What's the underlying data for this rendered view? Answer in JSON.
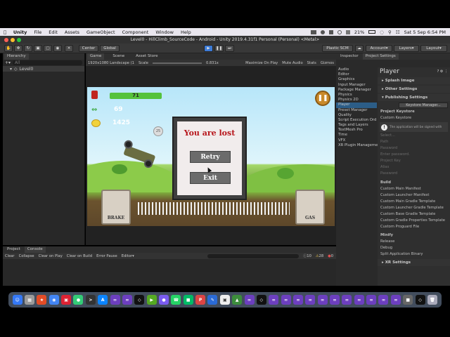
{
  "menubar": {
    "apple": "",
    "app": "Unity",
    "items": [
      "File",
      "Edit",
      "Assets",
      "GameObject",
      "Component",
      "Window",
      "Help"
    ],
    "battery": "21%",
    "clock": "Sat 5 Sep  6:54 PM"
  },
  "window": {
    "title": "Level0 - HillClimb_SourceCode - Android - Unity 2019.4.31f1 Personal (Personal) <Metal>"
  },
  "toolbar": {
    "center": "Center",
    "global": "Global",
    "collab": "Plastic SCM",
    "account": "Account",
    "layers": "Layers",
    "layout": "Layout"
  },
  "hierarchy": {
    "tab": "Hierarchy",
    "search_placeholder": "All",
    "scene": "Level0"
  },
  "gameview": {
    "tabs": [
      "Game",
      "Scene",
      "Asset Store"
    ],
    "resolution": "1920x1080 Landscape (1",
    "scale_label": "Scale",
    "scale_value": "0.831x",
    "options": [
      "Maximize On Play",
      "Mute Audio",
      "Stats",
      "Gizmos"
    ]
  },
  "game": {
    "fuel": "71",
    "distance": "69",
    "coins": "1425",
    "lost_title": "You are lost",
    "retry": "Retry",
    "exit": "Exit",
    "brake": "BRAKE",
    "gas": "GAS",
    "coin_small": "25"
  },
  "project_settings": {
    "tabs": [
      "Inspector",
      "Project Settings"
    ],
    "categories": [
      "Audio",
      "Editor",
      "Graphics",
      "Input Manager",
      "Package Manager",
      "Physics",
      "Physics 2D",
      "Player",
      "Preset Manager",
      "Quality",
      "Script Execution Ord",
      "Tags and Layers",
      "TextMesh Pro",
      "Time",
      "VFX",
      "XR Plugin Manageme"
    ],
    "selected_index": 7,
    "panel_title": "Player",
    "sections": {
      "splash": "Splash Image",
      "other": "Other Settings",
      "publishing": "Publishing Settings",
      "keystore_button": "Keystore Manager...",
      "project_keystore": "Project Keystore",
      "custom_keystore": "Custom Keystore",
      "warning": "The application will be signed with",
      "select": "Select...",
      "path": "Path",
      "password": "Password",
      "enter_password": "Enter password.",
      "project_key": "Project Key",
      "alias": "Alias",
      "key_password": "Password",
      "build": "Build",
      "build_items": [
        "Custom Main Manifest",
        "Custom Launcher Manifest",
        "Custom Main Gradle Template",
        "Custom Launcher Gradle Template",
        "Custom Base Gradle Template",
        "Custom Gradle Properties Template",
        "Custom Proguard File"
      ],
      "minify": "Minify",
      "release": "Release",
      "debug": "Debug",
      "split": "Split Application Binary",
      "xr": "XR Settings"
    }
  },
  "console": {
    "tabs": [
      "Project",
      "Console"
    ],
    "buttons": [
      "Clear",
      "Collapse",
      "Clear on Play",
      "Clear on Build",
      "Error Pause",
      "Editor"
    ],
    "count_info": "10",
    "count_warn": "28",
    "count_err": "0"
  },
  "colors": {
    "play_active": "#3d7bd6",
    "fuel_bar": "#55c23b",
    "lost_title": "#b7151b"
  }
}
